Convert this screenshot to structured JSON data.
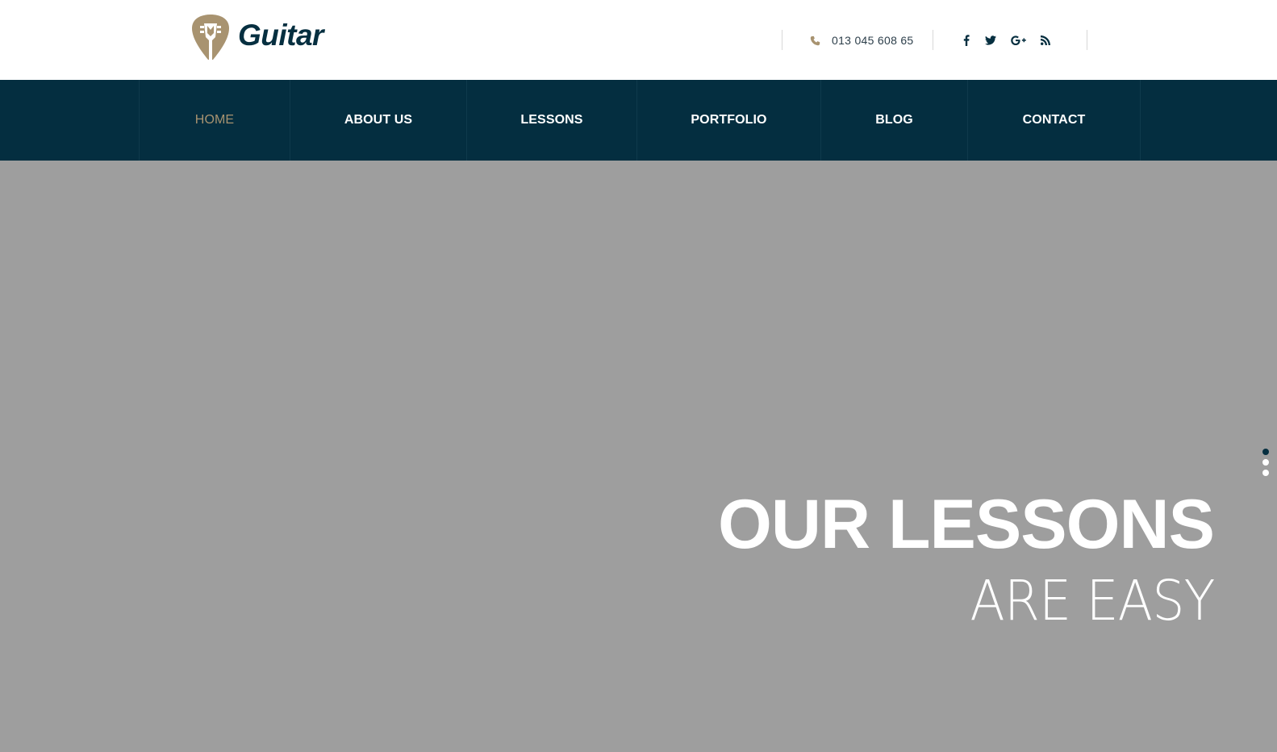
{
  "header": {
    "logo_text": "Guitar",
    "phone": "013 045 608 65",
    "socials": [
      {
        "icon": "facebook-icon"
      },
      {
        "icon": "twitter-icon"
      },
      {
        "icon": "google-plus-icon"
      },
      {
        "icon": "rss-icon"
      }
    ]
  },
  "nav": {
    "items": [
      {
        "label": "HOME",
        "active": true
      },
      {
        "label": "ABOUT US"
      },
      {
        "label": "LESSONS"
      },
      {
        "label": "PORTFOLIO"
      },
      {
        "label": "BLOG"
      },
      {
        "label": "CONTACT"
      }
    ]
  },
  "hero": {
    "title": "OUR LESSONS",
    "subtitle": "ARE EASY",
    "slides": 3,
    "active_slide": 1
  },
  "colors": {
    "brand_dark": "#042e40",
    "accent_gold": "#a89370",
    "hero_bg": "#9e9e9e"
  }
}
